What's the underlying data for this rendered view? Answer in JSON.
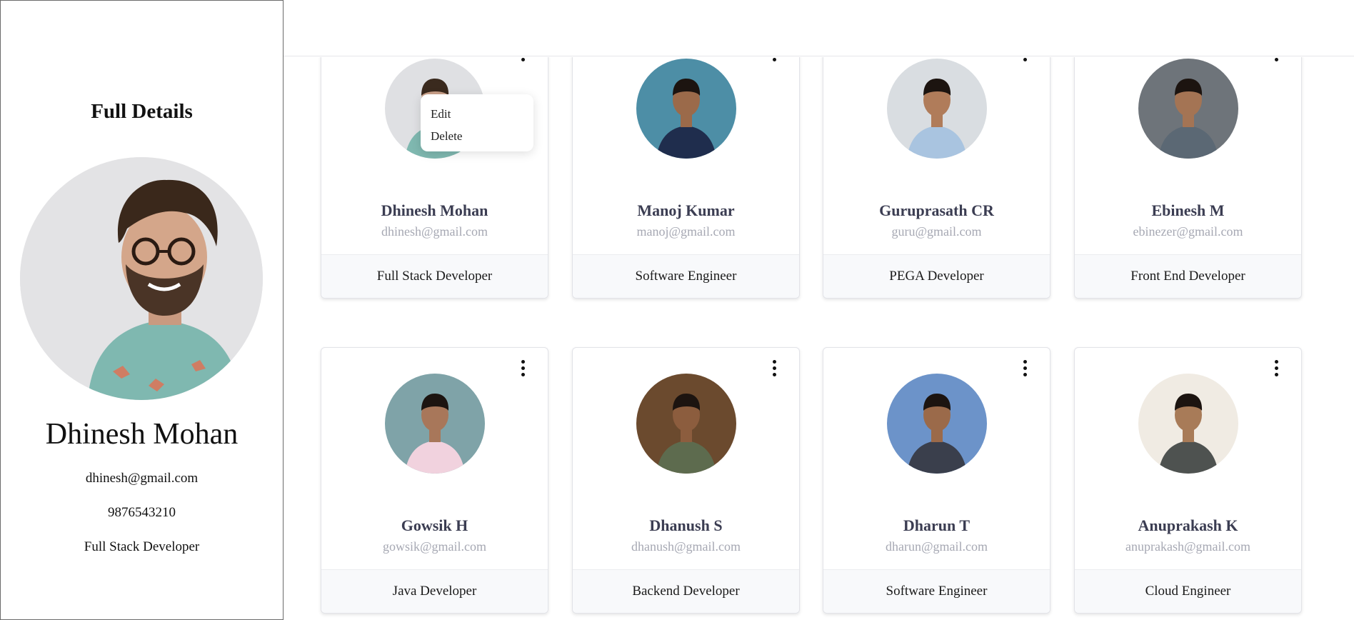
{
  "detail": {
    "title": "Full Details",
    "name": "Dhinesh Mohan",
    "email": "dhinesh@gmail.com",
    "phone": "9876543210",
    "role": "Full Stack Developer",
    "avatar_icon": "person-photo"
  },
  "menu": {
    "edit_label": "Edit",
    "delete_label": "Delete"
  },
  "cards": [
    {
      "name": "Dhinesh Mohan",
      "email": "dhinesh@gmail.com",
      "role": "Full Stack Developer",
      "bg": "#dfe0e3",
      "skin": "#caa089",
      "hair": "#3a2a1e",
      "shirt": "#7fb8b0"
    },
    {
      "name": "Manoj Kumar",
      "email": "manoj@gmail.com",
      "role": "Software Engineer",
      "bg": "#4d8ea6",
      "skin": "#9b6a4a",
      "hair": "#1c1410",
      "shirt": "#1f2d4d"
    },
    {
      "name": "Guruprasath CR",
      "email": "guru@gmail.com",
      "role": "PEGA Developer",
      "bg": "#d9dde1",
      "skin": "#b07c5a",
      "hair": "#1c1410",
      "shirt": "#a9c4e0"
    },
    {
      "name": "Ebinesh M",
      "email": "ebinezer@gmail.com",
      "role": "Front End Developer",
      "bg": "#6e747a",
      "skin": "#a47454",
      "hair": "#1c1410",
      "shirt": "#5b6874"
    },
    {
      "name": "Gowsik H",
      "email": "gowsik@gmail.com",
      "role": "Java Developer",
      "bg": "#7fa3a8",
      "skin": "#a8775a",
      "hair": "#1c1410",
      "shirt": "#f1d2de"
    },
    {
      "name": "Dhanush S",
      "email": "dhanush@gmail.com",
      "role": "Backend Developer",
      "bg": "#6b4a2e",
      "skin": "#8c5d3e",
      "hair": "#1c1410",
      "shirt": "#5d6b4e"
    },
    {
      "name": "Dharun T",
      "email": "dharun@gmail.com",
      "role": "Software Engineer",
      "bg": "#6c93c9",
      "skin": "#9b6a4a",
      "hair": "#1c1410",
      "shirt": "#3a3f4c"
    },
    {
      "name": "Anuprakash K",
      "email": "anuprakash@gmail.com",
      "role": "Cloud Engineer",
      "bg": "#f0ebe3",
      "skin": "#a87b58",
      "hair": "#1c1410",
      "shirt": "#4e5250"
    }
  ]
}
